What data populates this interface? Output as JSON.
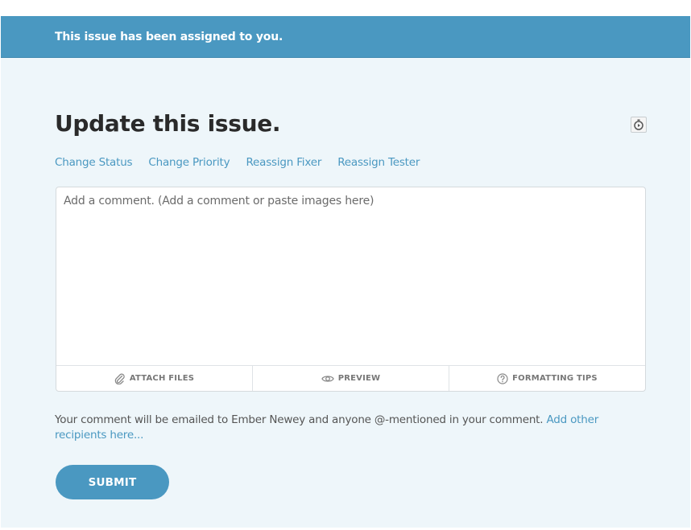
{
  "banner": {
    "message": "This issue has been assigned to you."
  },
  "header": {
    "title": "Update this issue.",
    "timer_icon": "stopwatch-icon"
  },
  "actions": [
    {
      "label": "Change Status"
    },
    {
      "label": "Change Priority"
    },
    {
      "label": "Reassign Fixer"
    },
    {
      "label": "Reassign Tester"
    }
  ],
  "comment": {
    "placeholder": "Add a comment. (Add a comment or paste images here)",
    "value": ""
  },
  "toolbar": {
    "attach_label": "ATTACH FILES",
    "attach_icon": "paperclip-icon",
    "preview_label": "PREVIEW",
    "preview_icon": "eye-icon",
    "tips_label": "FORMATTING TIPS",
    "tips_icon": "question-circle-icon"
  },
  "notice": {
    "text": "Your comment will be emailed to Ember Newey and anyone @-mentioned in your comment. ",
    "link": "Add other recipients here..."
  },
  "submit": {
    "label": "SUBMIT"
  },
  "colors": {
    "accent": "#4a98c1",
    "panel_background": "#eef6fa",
    "title_text": "#2a2a2a"
  }
}
